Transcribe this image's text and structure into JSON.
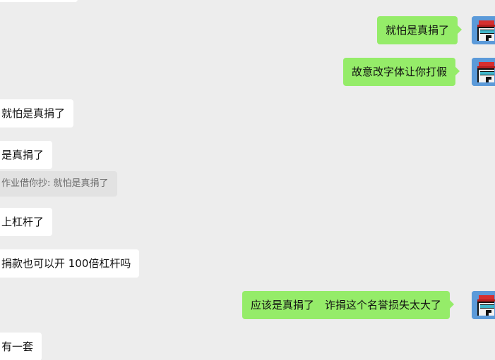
{
  "messages": {
    "m1": {
      "text": "就怕是真捐了"
    },
    "m2": {
      "text": "故意改字体让你打假"
    },
    "m3": {
      "text": "就怕是真捐了"
    },
    "m4": {
      "text": "是真捐了"
    },
    "m4_quote": {
      "text": "作业借你抄: 就怕是真捐了"
    },
    "m5": {
      "text": "上杠杆了"
    },
    "m6": {
      "text": "捐款也可以开 100倍杠杆吗"
    },
    "m7": {
      "text": "应该是真捐了　诈捐这个名誉损失太大了"
    },
    "m8": {
      "text": "有一套"
    }
  },
  "colors": {
    "background": "#ededed",
    "incoming_bubble": "#ffffff",
    "outgoing_bubble": "#95ec69",
    "quote_bubble": "#e2e2e2",
    "avatar_bg": "#5b9ad9",
    "avatar_hat": "#d62f2f"
  },
  "icons": {
    "self_avatar": "pixel-avatar-red-cap"
  }
}
